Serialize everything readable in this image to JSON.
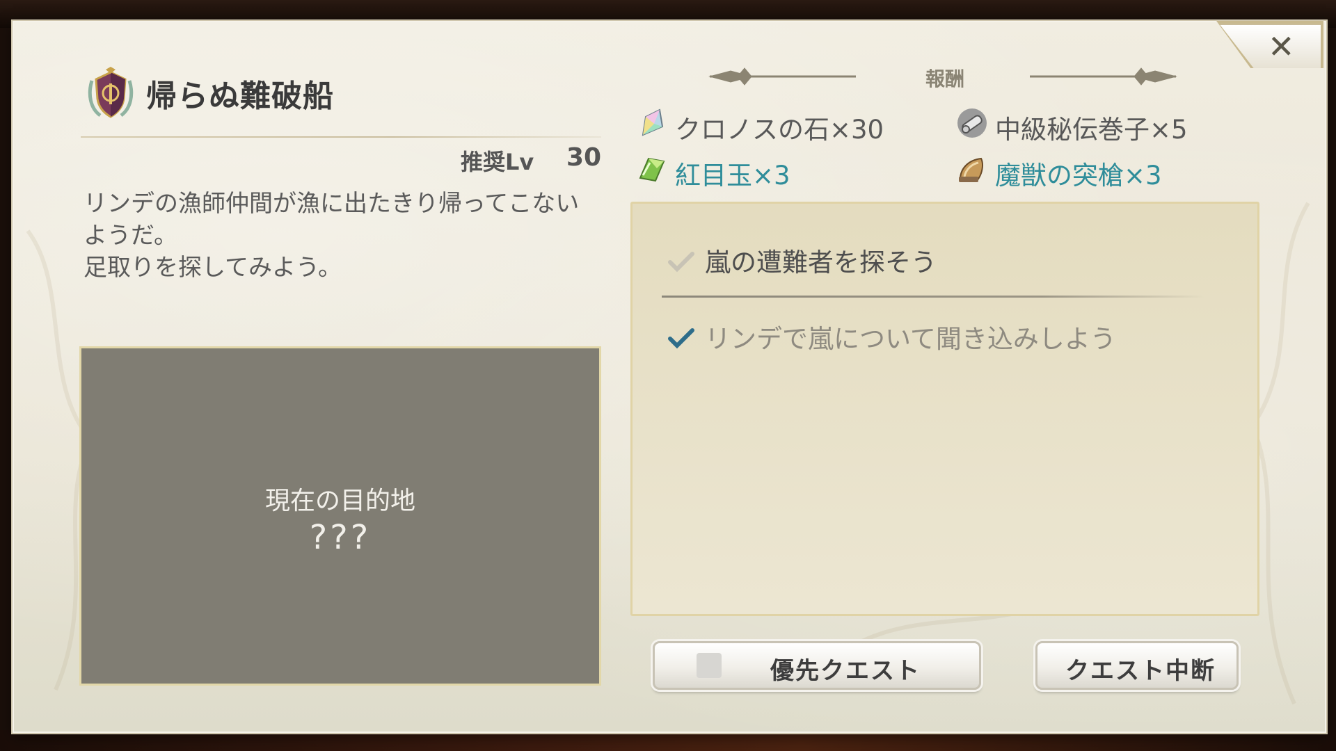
{
  "quest": {
    "title": "帰らぬ難破船",
    "recommended_label": "推奨Lv",
    "recommended_level": "30",
    "description": "リンデの漁師仲間が漁に出たきり帰ってこない\nようだ。\n足取りを探してみよう。"
  },
  "destination": {
    "label": "現在の目的地",
    "value": "???"
  },
  "rewards": {
    "title": "報酬",
    "items": [
      {
        "icon": "chronos-stone-icon",
        "text": "クロノスの石×30",
        "color": "#585858"
      },
      {
        "icon": "intermediate-scroll-icon",
        "text": "中級秘伝巻子×5",
        "color": "#585858"
      },
      {
        "icon": "red-eye-gem-icon",
        "text": "紅目玉×3",
        "color": "#2f8d9a"
      },
      {
        "icon": "beast-horn-icon",
        "text": "魔獣の突槍×3",
        "color": "#2f8d9a"
      }
    ]
  },
  "objectives": [
    {
      "text": "嵐の遭難者を探そう",
      "status": "current"
    },
    {
      "text": "リンデで嵐について聞き込みしよう",
      "status": "done"
    }
  ],
  "buttons": {
    "priority": "優先クエスト",
    "abort": "クエスト中断"
  },
  "close_symbol": "✕"
}
